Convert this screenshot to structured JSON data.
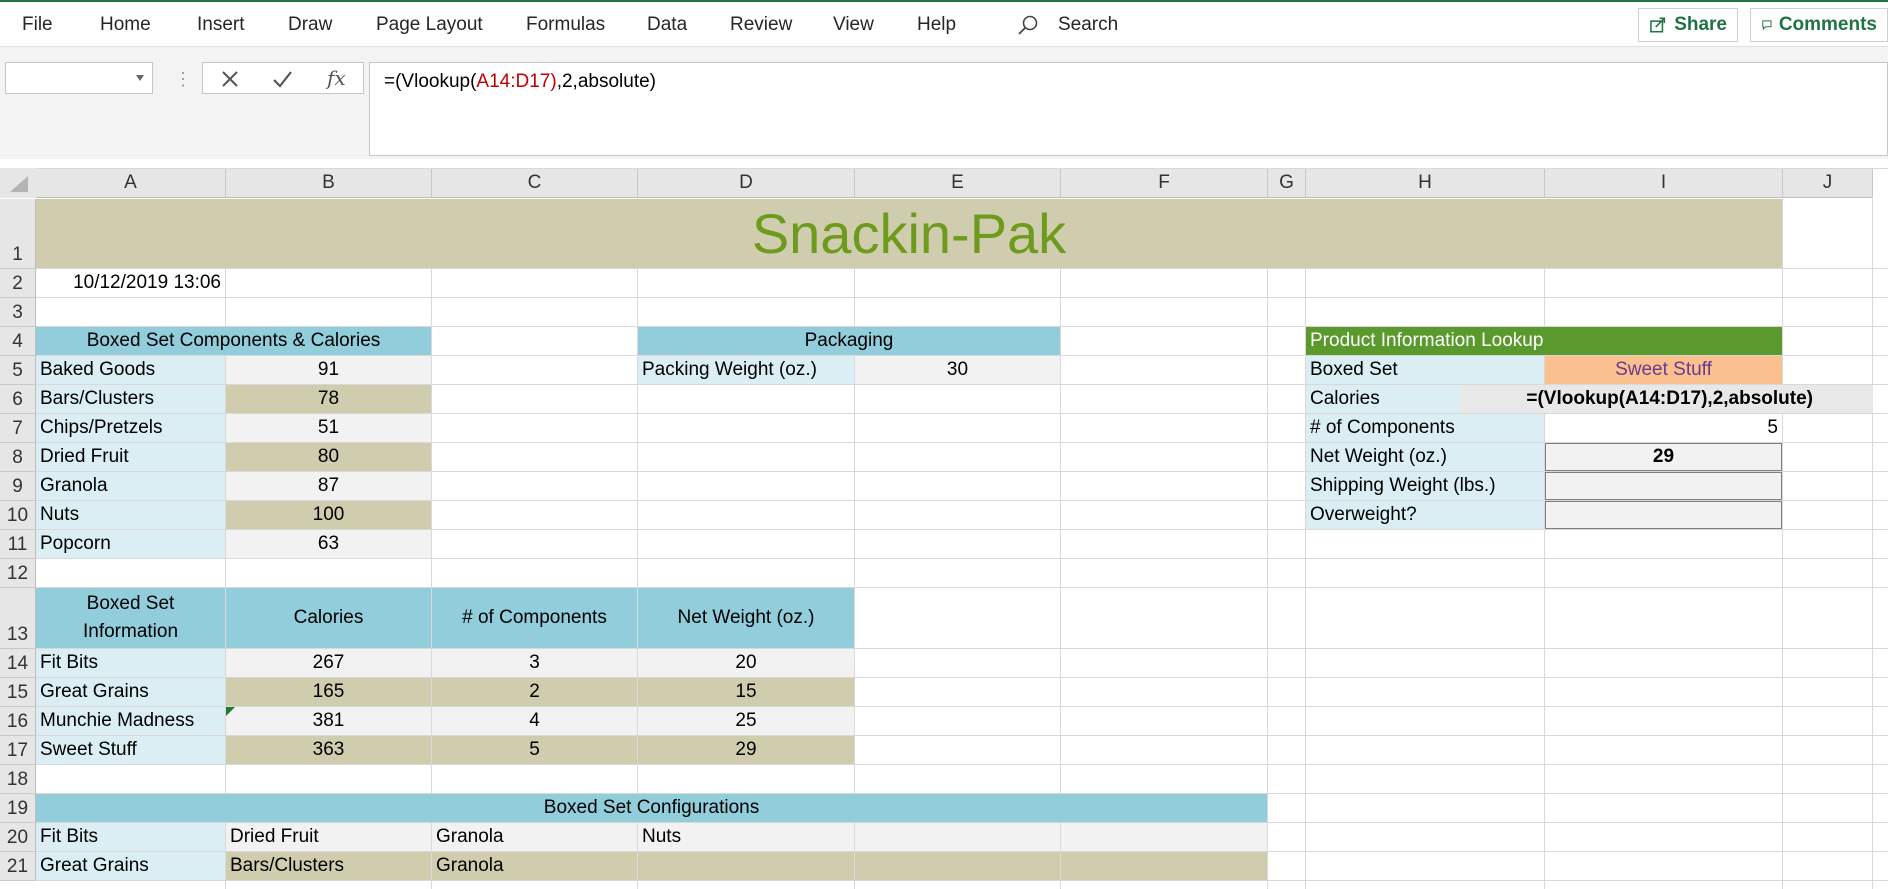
{
  "menu": {
    "items": [
      "File",
      "Home",
      "Insert",
      "Draw",
      "Page Layout",
      "Formulas",
      "Data",
      "Review",
      "View",
      "Help"
    ],
    "search_label": "Search",
    "share_label": "Share",
    "comments_label": "Comments"
  },
  "formula_bar": {
    "name_box_value": "",
    "formula_prefix": "=(Vlookup(",
    "formula_ref": "A14:D17",
    "formula_paren": ")",
    "formula_suffix": ",2,absolute)"
  },
  "columns": [
    "A",
    "B",
    "C",
    "D",
    "E",
    "F",
    "G",
    "H",
    "I",
    "J"
  ],
  "rows": [
    "1",
    "2",
    "3",
    "4",
    "5",
    "6",
    "7",
    "8",
    "9",
    "10",
    "11",
    "12",
    "13",
    "14",
    "15",
    "16",
    "17",
    "18",
    "19",
    "20",
    "21"
  ],
  "sheet": {
    "title": "Snackin-Pak",
    "timestamp": "10/12/2019 13:06",
    "components": {
      "header": "Boxed Set Components & Calories",
      "items": [
        {
          "name": "Baked Goods",
          "calories": "91"
        },
        {
          "name": "Bars/Clusters",
          "calories": "78"
        },
        {
          "name": "Chips/Pretzels",
          "calories": "51"
        },
        {
          "name": "Dried Fruit",
          "calories": "80"
        },
        {
          "name": "Granola",
          "calories": "87"
        },
        {
          "name": "Nuts",
          "calories": "100"
        },
        {
          "name": "Popcorn",
          "calories": "63"
        }
      ]
    },
    "packaging": {
      "header": "Packaging",
      "label": "Packing Weight (oz.)",
      "value": "30"
    },
    "lookup": {
      "header": "Product Information Lookup",
      "boxed_set_label": "Boxed Set",
      "boxed_set_value": "Sweet Stuff",
      "calories_label": "Calories",
      "calories_value": "=(Vlookup(A14:D17),2,absolute)",
      "components_label": "# of Components",
      "components_value": "5",
      "net_weight_label": "Net Weight (oz.)",
      "net_weight_value": "29",
      "shipping_label": "Shipping Weight (lbs.)",
      "shipping_value": "",
      "overweight_label": "Overweight?",
      "overweight_value": ""
    },
    "info": {
      "headers": [
        "Boxed Set",
        "Information",
        "Calories",
        "# of Components",
        "Net Weight (oz.)"
      ],
      "rows": [
        {
          "name": "Fit Bits",
          "calories": "267",
          "components": "3",
          "weight": "20"
        },
        {
          "name": "Great Grains",
          "calories": "165",
          "components": "2",
          "weight": "15"
        },
        {
          "name": "Munchie Madness",
          "calories": "381",
          "components": "4",
          "weight": "25"
        },
        {
          "name": "Sweet Stuff",
          "calories": "363",
          "components": "5",
          "weight": "29"
        }
      ]
    },
    "configurations": {
      "header": "Boxed Set Configurations",
      "rows": [
        {
          "name": "Fit Bits",
          "items": [
            "Dried Fruit",
            "Granola",
            "Nuts"
          ]
        },
        {
          "name": "Great Grains",
          "items": [
            "Bars/Clusters",
            "Granola",
            ""
          ]
        }
      ]
    }
  },
  "colors": {
    "excel_green": "#217346",
    "title_green": "#6e9a1e",
    "header_blue": "#92cddc",
    "label_blue": "#daeef3",
    "tan": "#d0cdae",
    "lookup_green": "#5a9a2c",
    "orange": "#fac090"
  }
}
